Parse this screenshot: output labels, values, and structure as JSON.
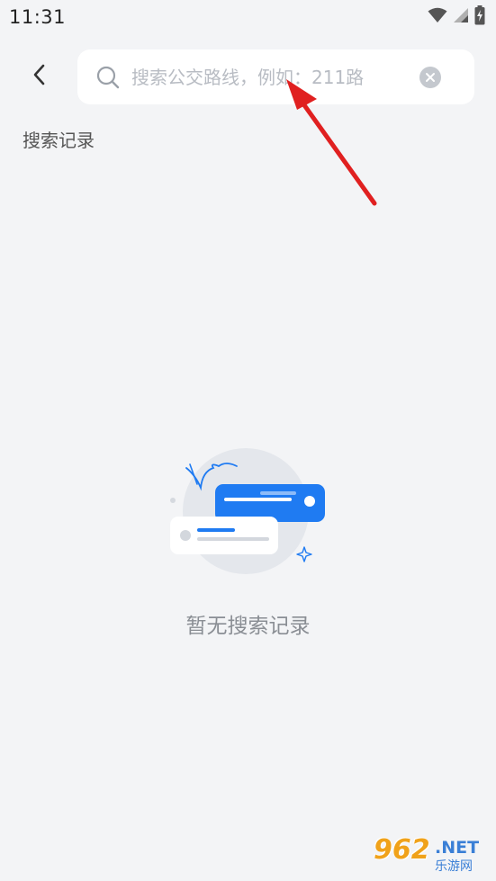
{
  "status_bar": {
    "time": "11:31",
    "icons": [
      "wifi-icon",
      "signal-icon",
      "battery-charging-icon"
    ]
  },
  "header": {
    "back_icon": "chevron-left-icon",
    "search": {
      "placeholder": "搜索公交路线，例如：211路",
      "value": "",
      "search_icon": "search-icon",
      "clear_icon": "clear-icon"
    }
  },
  "history": {
    "title": "搜索记录",
    "items": []
  },
  "empty_state": {
    "illustration": "empty-chat-bubbles-illustration",
    "text": "暂无搜索记录"
  },
  "watermark": {
    "brand_number": "962",
    "brand_suffix": ".NET",
    "brand_sub": "乐游网"
  },
  "colors": {
    "background": "#f3f4f6",
    "accent_blue": "#1f7bf2",
    "annotation_red": "#e02020",
    "placeholder": "#b8bcc3"
  }
}
